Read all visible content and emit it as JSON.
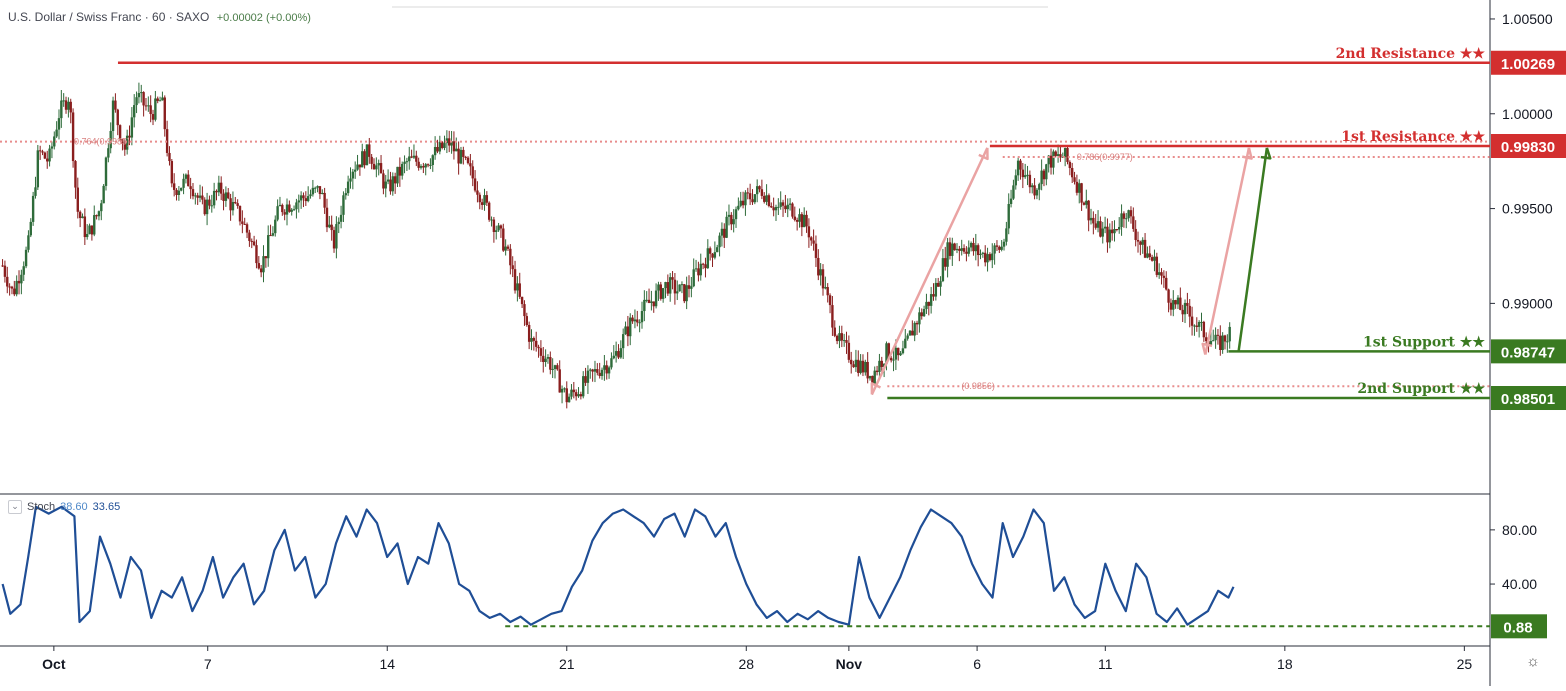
{
  "header": {
    "title": "U.S. Dollar / Swiss Franc · 60 · SAXO",
    "change": "+0.00002 (+0.00%)"
  },
  "stoch_header": {
    "name": "Stoch",
    "k_value": "38.60",
    "d_value": "33.65",
    "collapse_icon": "chevron-down-icon"
  },
  "colors": {
    "resistance": "#d32f2f",
    "support": "#3a7a21",
    "fib": "#e88d8d",
    "arrow_pink": "#eaa3a3",
    "arrow_green": "#3a7a21",
    "candle_up": "#2e6b3a",
    "candle_down": "#8a1e1e",
    "stoch": "#1f4e96"
  },
  "chart_data": [
    {
      "type": "candlestick",
      "title": "U.S. Dollar / Swiss Franc · 60 · SAXO",
      "ylim": [
        0.98,
        1.006
      ],
      "y_ticks": [
        "1.00500",
        "1.00000",
        "0.99500",
        "0.99000"
      ],
      "y_tick_values": [
        1.005,
        1.0,
        0.995,
        0.99
      ],
      "x_ticks": [
        "Oct",
        "7",
        "14",
        "21",
        "28",
        "Nov",
        "6",
        "11",
        "18",
        "25"
      ],
      "x_tick_days": [
        1,
        7,
        14,
        21,
        28,
        32,
        37,
        42,
        49,
        56
      ],
      "x_range_days": [
        -1.1,
        57
      ],
      "grid": false,
      "price_path": [
        [
          -1.0,
          0.992
        ],
        [
          -0.6,
          0.9905
        ],
        [
          0.0,
          0.993
        ],
        [
          0.4,
          0.998
        ],
        [
          0.8,
          0.9975
        ],
        [
          1.2,
          1.0
        ],
        [
          1.6,
          1.001
        ],
        [
          1.9,
          0.995
        ],
        [
          2.3,
          0.9935
        ],
        [
          2.8,
          0.995
        ],
        [
          3.3,
          1.0005
        ],
        [
          3.8,
          0.998
        ],
        [
          4.2,
          1.001
        ],
        [
          4.8,
          1.0
        ],
        [
          5.2,
          1.0008
        ],
        [
          5.6,
          0.996
        ],
        [
          6.3,
          0.9965
        ],
        [
          6.8,
          0.995
        ],
        [
          7.5,
          0.996
        ],
        [
          8.3,
          0.9945
        ],
        [
          9.1,
          0.992
        ],
        [
          9.8,
          0.995
        ],
        [
          10.6,
          0.9955
        ],
        [
          11.4,
          0.996
        ],
        [
          11.9,
          0.993
        ],
        [
          12.5,
          0.997
        ],
        [
          13.3,
          0.998
        ],
        [
          14.0,
          0.996
        ],
        [
          14.8,
          0.9975
        ],
        [
          15.5,
          0.9975
        ],
        [
          16.4,
          0.9985
        ],
        [
          17.2,
          0.997
        ],
        [
          17.9,
          0.995
        ],
        [
          18.6,
          0.993
        ],
        [
          19.2,
          0.99
        ],
        [
          19.6,
          0.988
        ],
        [
          20.3,
          0.987
        ],
        [
          21.0,
          0.985
        ],
        [
          21.5,
          0.9855
        ],
        [
          22.2,
          0.9865
        ],
        [
          22.8,
          0.987
        ],
        [
          23.5,
          0.989
        ],
        [
          24.2,
          0.99
        ],
        [
          24.9,
          0.991
        ],
        [
          25.6,
          0.9905
        ],
        [
          26.2,
          0.992
        ],
        [
          26.8,
          0.993
        ],
        [
          27.4,
          0.9945
        ],
        [
          28.0,
          0.9955
        ],
        [
          28.6,
          0.996
        ],
        [
          29.2,
          0.995
        ],
        [
          29.8,
          0.995
        ],
        [
          30.4,
          0.994
        ],
        [
          31.0,
          0.991
        ],
        [
          31.6,
          0.988
        ],
        [
          32.2,
          0.987
        ],
        [
          32.9,
          0.9862
        ],
        [
          33.5,
          0.9875
        ],
        [
          34.0,
          0.987
        ],
        [
          34.6,
          0.989
        ],
        [
          35.3,
          0.9905
        ],
        [
          35.9,
          0.993
        ],
        [
          36.6,
          0.993
        ],
        [
          37.3,
          0.9925
        ],
        [
          38.0,
          0.993
        ],
        [
          38.6,
          0.9975
        ],
        [
          39.2,
          0.996
        ],
        [
          39.8,
          0.9975
        ],
        [
          40.4,
          0.9978
        ],
        [
          41.0,
          0.996
        ],
        [
          41.6,
          0.994
        ],
        [
          42.2,
          0.9935
        ],
        [
          42.8,
          0.995
        ],
        [
          43.4,
          0.993
        ],
        [
          44.0,
          0.992
        ],
        [
          44.6,
          0.99
        ],
        [
          45.2,
          0.9895
        ],
        [
          45.8,
          0.9885
        ],
        [
          46.4,
          0.9878
        ],
        [
          46.9,
          0.9885
        ]
      ],
      "levels": [
        {
          "label": "2nd Resistance ★★",
          "value": 1.00269,
          "value_label": "1.00269",
          "kind": "resistance",
          "start_day": 3.5
        },
        {
          "label": "1st Resistance ★★",
          "value": 0.9983,
          "value_label": "0.99830",
          "kind": "resistance",
          "start_day": 37.5
        },
        {
          "label": "1st Support ★★",
          "value": 0.98747,
          "value_label": "0.98747",
          "kind": "support",
          "start_day": 46.8
        },
        {
          "label": "2nd Support ★★",
          "value": 0.98501,
          "value_label": "0.98501",
          "kind": "support",
          "start_day": 33.5
        }
      ],
      "fib_lines": [
        {
          "label": "0.764(0.9985)",
          "value": 0.99853,
          "start_day": -1.1
        },
        {
          "label": "0.786(0.9977)",
          "value": 0.99772,
          "start_day": 38.0
        },
        {
          "label": "(0.9856)",
          "value": 0.98563,
          "start_day": 33.5
        }
      ],
      "arrows": [
        {
          "from": [
            32.9,
            0.9852
          ],
          "to": [
            37.4,
            0.9982
          ],
          "color": "arrow_pink",
          "double": true
        },
        {
          "from": [
            45.9,
            0.9873
          ],
          "to": [
            47.6,
            0.9982
          ],
          "color": "arrow_pink",
          "double": true
        },
        {
          "from": [
            47.2,
            0.9875
          ],
          "to": [
            48.3,
            0.9982
          ],
          "color": "arrow_green",
          "double": false
        }
      ]
    },
    {
      "type": "line",
      "title": "Stoch",
      "ylim": [
        -5,
        105
      ],
      "y_ticks": [
        "80.00",
        "40.00"
      ],
      "y_tick_values": [
        80,
        40
      ],
      "x_range_days": [
        -1.1,
        57
      ],
      "series": [
        {
          "name": "Stoch",
          "points": [
            [
              -1.0,
              40
            ],
            [
              -0.7,
              18
            ],
            [
              -0.3,
              25
            ],
            [
              0.0,
              60
            ],
            [
              0.3,
              97
            ],
            [
              0.8,
              92
            ],
            [
              1.3,
              97
            ],
            [
              1.8,
              90
            ],
            [
              2.0,
              12
            ],
            [
              2.4,
              20
            ],
            [
              2.8,
              75
            ],
            [
              3.2,
              55
            ],
            [
              3.6,
              30
            ],
            [
              4.0,
              60
            ],
            [
              4.4,
              50
            ],
            [
              4.8,
              15
            ],
            [
              5.2,
              35
            ],
            [
              5.6,
              30
            ],
            [
              6.0,
              45
            ],
            [
              6.4,
              20
            ],
            [
              6.8,
              35
            ],
            [
              7.2,
              60
            ],
            [
              7.6,
              30
            ],
            [
              8.0,
              45
            ],
            [
              8.4,
              55
            ],
            [
              8.8,
              25
            ],
            [
              9.2,
              35
            ],
            [
              9.6,
              65
            ],
            [
              10.0,
              80
            ],
            [
              10.4,
              50
            ],
            [
              10.8,
              60
            ],
            [
              11.2,
              30
            ],
            [
              11.6,
              40
            ],
            [
              12.0,
              70
            ],
            [
              12.4,
              90
            ],
            [
              12.8,
              75
            ],
            [
              13.2,
              95
            ],
            [
              13.6,
              85
            ],
            [
              14.0,
              60
            ],
            [
              14.4,
              70
            ],
            [
              14.8,
              40
            ],
            [
              15.2,
              60
            ],
            [
              15.6,
              55
            ],
            [
              16.0,
              85
            ],
            [
              16.4,
              70
            ],
            [
              16.8,
              40
            ],
            [
              17.2,
              35
            ],
            [
              17.6,
              20
            ],
            [
              18.0,
              15
            ],
            [
              18.4,
              18
            ],
            [
              18.8,
              12
            ],
            [
              19.2,
              16
            ],
            [
              19.6,
              10
            ],
            [
              20.0,
              14
            ],
            [
              20.4,
              18
            ],
            [
              20.8,
              20
            ],
            [
              21.2,
              38
            ],
            [
              21.6,
              50
            ],
            [
              22.0,
              72
            ],
            [
              22.4,
              85
            ],
            [
              22.8,
              92
            ],
            [
              23.2,
              95
            ],
            [
              23.6,
              90
            ],
            [
              24.0,
              85
            ],
            [
              24.4,
              75
            ],
            [
              24.8,
              88
            ],
            [
              25.2,
              92
            ],
            [
              25.6,
              75
            ],
            [
              26.0,
              95
            ],
            [
              26.4,
              90
            ],
            [
              26.8,
              75
            ],
            [
              27.2,
              85
            ],
            [
              27.6,
              60
            ],
            [
              28.0,
              40
            ],
            [
              28.4,
              25
            ],
            [
              28.8,
              15
            ],
            [
              29.2,
              20
            ],
            [
              29.6,
              12
            ],
            [
              30.0,
              18
            ],
            [
              30.4,
              14
            ],
            [
              30.8,
              20
            ],
            [
              31.2,
              15
            ],
            [
              31.6,
              12
            ],
            [
              32.0,
              10
            ],
            [
              32.4,
              60
            ],
            [
              32.8,
              30
            ],
            [
              33.2,
              15
            ],
            [
              33.6,
              30
            ],
            [
              34.0,
              45
            ],
            [
              34.4,
              65
            ],
            [
              34.8,
              82
            ],
            [
              35.2,
              95
            ],
            [
              35.6,
              90
            ],
            [
              36.0,
              85
            ],
            [
              36.4,
              75
            ],
            [
              36.8,
              55
            ],
            [
              37.2,
              40
            ],
            [
              37.6,
              30
            ],
            [
              38.0,
              85
            ],
            [
              38.4,
              60
            ],
            [
              38.8,
              75
            ],
            [
              39.2,
              95
            ],
            [
              39.6,
              85
            ],
            [
              40.0,
              35
            ],
            [
              40.4,
              45
            ],
            [
              40.8,
              25
            ],
            [
              41.2,
              15
            ],
            [
              41.6,
              20
            ],
            [
              42.0,
              55
            ],
            [
              42.4,
              35
            ],
            [
              42.8,
              20
            ],
            [
              43.2,
              55
            ],
            [
              43.6,
              45
            ],
            [
              44.0,
              18
            ],
            [
              44.4,
              12
            ],
            [
              44.8,
              22
            ],
            [
              45.2,
              10
            ],
            [
              45.6,
              15
            ],
            [
              46.0,
              20
            ],
            [
              46.4,
              35
            ],
            [
              46.8,
              30
            ],
            [
              47.0,
              38
            ]
          ]
        }
      ],
      "levels": [
        {
          "value": 8.8,
          "value_label": "0.88",
          "start_day": 18.6
        }
      ]
    }
  ]
}
